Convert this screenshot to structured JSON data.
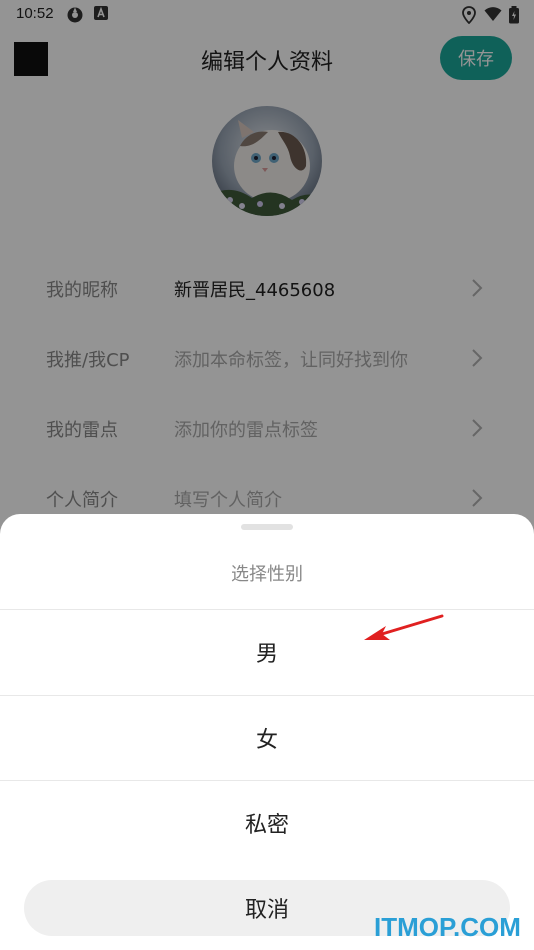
{
  "status_bar": {
    "time": "10:52"
  },
  "header": {
    "title": "编辑个人资料",
    "save_label": "保存"
  },
  "profile_rows": [
    {
      "label": "我的昵称",
      "value": "新晋居民_4465608",
      "filled": true
    },
    {
      "label": "我推/我CP",
      "value": "添加本命标签，让同好找到你",
      "filled": false
    },
    {
      "label": "我的雷点",
      "value": "添加你的雷点标签",
      "filled": false
    },
    {
      "label": "个人简介",
      "value": "填写个人简介",
      "filled": false
    }
  ],
  "gender_sheet": {
    "title": "选择性别",
    "options": [
      "男",
      "女",
      "私密"
    ],
    "cancel_label": "取消"
  },
  "watermark": "ITMOP.COM",
  "colors": {
    "accent": "#1aa79a",
    "arrow": "#e02020",
    "watermark": "#2a9fd6"
  },
  "icons": [
    "location-icon",
    "wifi-icon",
    "battery-icon",
    "chevron-right-icon"
  ]
}
